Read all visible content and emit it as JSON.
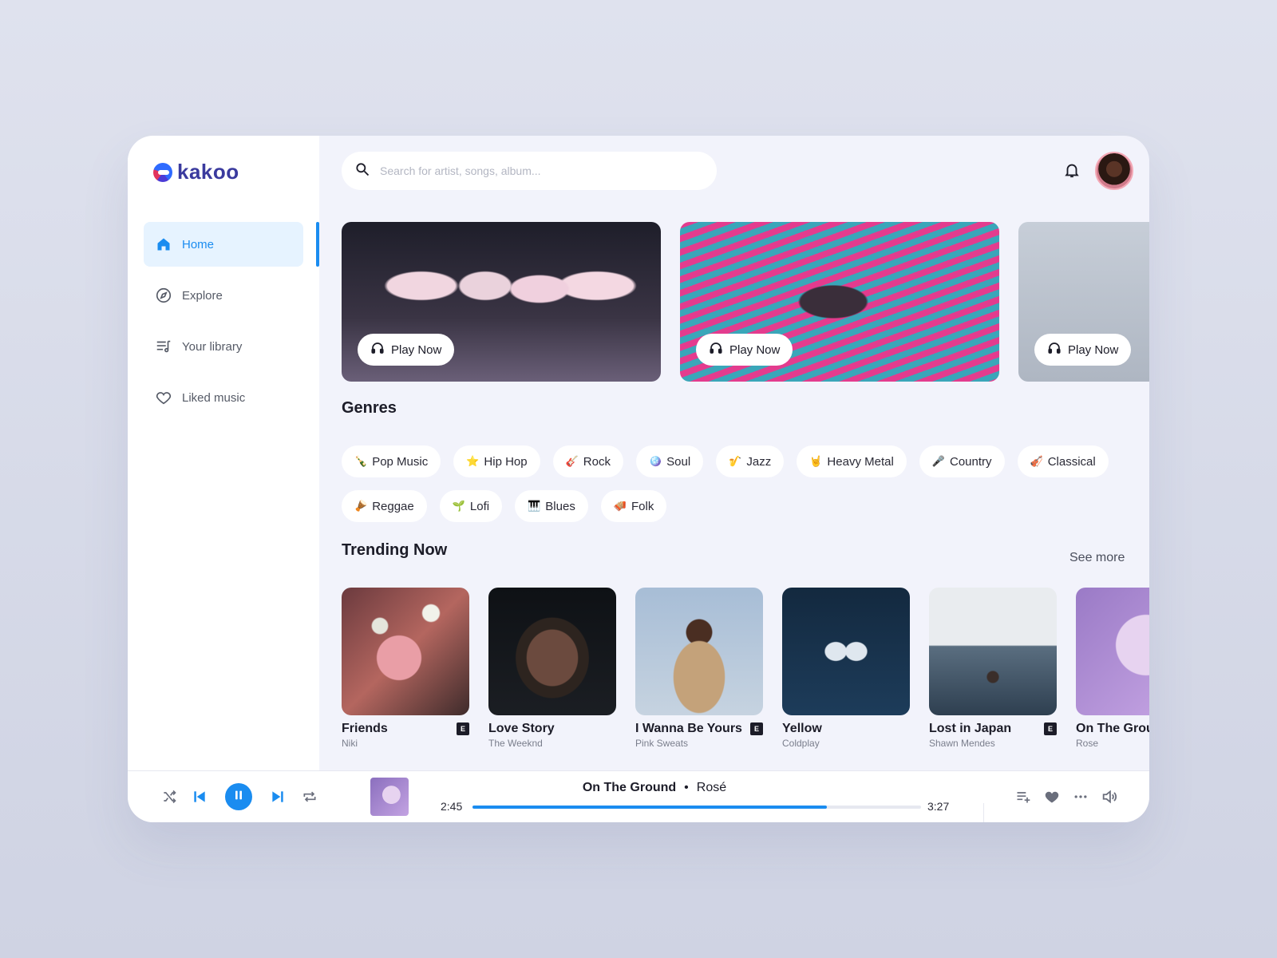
{
  "app": {
    "logo_text": "kakoo"
  },
  "colors": {
    "accent": "#1a8cf0",
    "background": "#f2f3fb",
    "sidebar": "#ffffff"
  },
  "sidebar": {
    "items": [
      {
        "label": "Home",
        "icon": "home-icon",
        "active": true
      },
      {
        "label": "Explore",
        "icon": "compass-icon",
        "active": false
      },
      {
        "label": "Your library",
        "icon": "library-icon",
        "active": false
      },
      {
        "label": "Liked music",
        "icon": "heart-icon",
        "active": false
      }
    ]
  },
  "search": {
    "placeholder": "Search for artist, songs, album...",
    "value": ""
  },
  "header": {
    "notification_icon": "bell-icon",
    "avatar_icon": "user-avatar"
  },
  "banners": [
    {
      "button_label": "Play Now"
    },
    {
      "button_label": "Play Now"
    },
    {
      "button_label": "Play Now"
    }
  ],
  "genres": {
    "title": "Genres",
    "rows": [
      [
        {
          "emoji": "🍾",
          "label": "Pop Music"
        },
        {
          "emoji": "⭐",
          "label": "Hip Hop"
        },
        {
          "emoji": "🎸",
          "label": "Rock"
        },
        {
          "emoji": "🪩",
          "label": "Soul"
        },
        {
          "emoji": "🎷",
          "label": "Jazz"
        },
        {
          "emoji": "🤘",
          "label": "Heavy Metal"
        },
        {
          "emoji": "🎤",
          "label": "Country"
        },
        {
          "emoji": "🎻",
          "label": "Classical"
        }
      ],
      [
        {
          "emoji": "🪘",
          "label": "Reggae"
        },
        {
          "emoji": "🌱",
          "label": "Lofi"
        },
        {
          "emoji": "🎹",
          "label": "Blues"
        },
        {
          "emoji": "🪗",
          "label": "Folk"
        }
      ]
    ]
  },
  "trending": {
    "title": "Trending Now",
    "see_more": "See more",
    "tracks": [
      {
        "title": "Friends",
        "artist": "Niki",
        "explicit": true
      },
      {
        "title": "Love Story",
        "artist": "The Weeknd",
        "explicit": false
      },
      {
        "title": "I Wanna Be Yours",
        "artist": "Pink Sweats",
        "explicit": true
      },
      {
        "title": "Yellow",
        "artist": "Coldplay",
        "explicit": false
      },
      {
        "title": "Lost in Japan",
        "artist": "Shawn Mendes",
        "explicit": true
      },
      {
        "title": "On The Grou",
        "artist": "Rose",
        "explicit": false
      }
    ],
    "explicit_label": "E"
  },
  "player": {
    "song": "On The Ground",
    "separator": "•",
    "artist": "Rosé",
    "elapsed": "2:45",
    "duration": "3:27",
    "progress_fraction": 0.79,
    "controls": [
      "shuffle-icon",
      "previous-icon",
      "pause-icon",
      "next-icon",
      "repeat-icon"
    ],
    "right_icons": [
      "add-to-queue-icon",
      "heart-icon",
      "more-icon",
      "volume-icon"
    ]
  }
}
